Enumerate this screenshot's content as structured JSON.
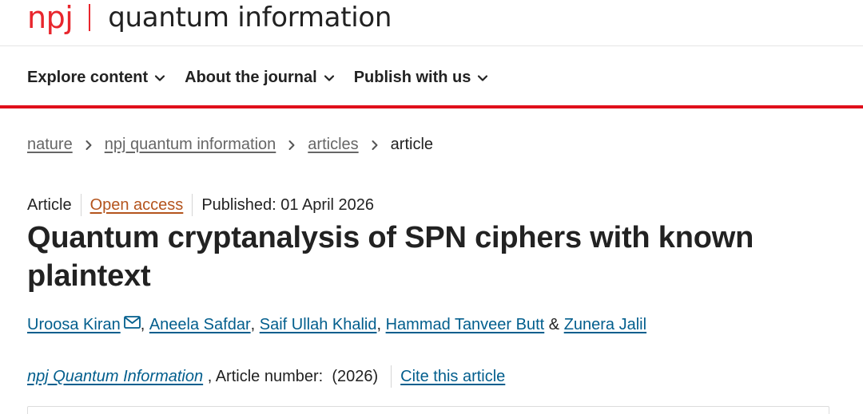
{
  "brand": {
    "logo": "npj",
    "name": "quantum information",
    "accent": "#e8262d"
  },
  "nav": {
    "items": [
      {
        "label": "Explore content"
      },
      {
        "label": "About the journal"
      },
      {
        "label": "Publish with us"
      }
    ]
  },
  "breadcrumb": {
    "items": [
      "nature",
      "npj quantum information",
      "articles"
    ],
    "current": "article"
  },
  "article": {
    "type": "Article",
    "access": "Open access",
    "published": "Published: 01 April 2026",
    "title_line1": "Quantum cryptanalysis of SPN ciphers with known",
    "title_line2": "plaintext",
    "authors": [
      "Uroosa Kiran",
      "Aneela Safdar",
      "Saif Ullah Khalid",
      "Hammad Tanveer Butt",
      "Zunera Jalil"
    ],
    "journal": "npj Quantum Information",
    "article_number": ", Article number:",
    "year": "(2026)",
    "cite_label": "Cite this article"
  },
  "icons": {
    "chevron": "chevron-down-icon",
    "crumb_separator": "chevron-right-icon",
    "contact": "mail-icon"
  },
  "colors": {
    "link": "#025e8d",
    "open_access": "#b4541d",
    "nav_rule": "#e00f1b"
  }
}
